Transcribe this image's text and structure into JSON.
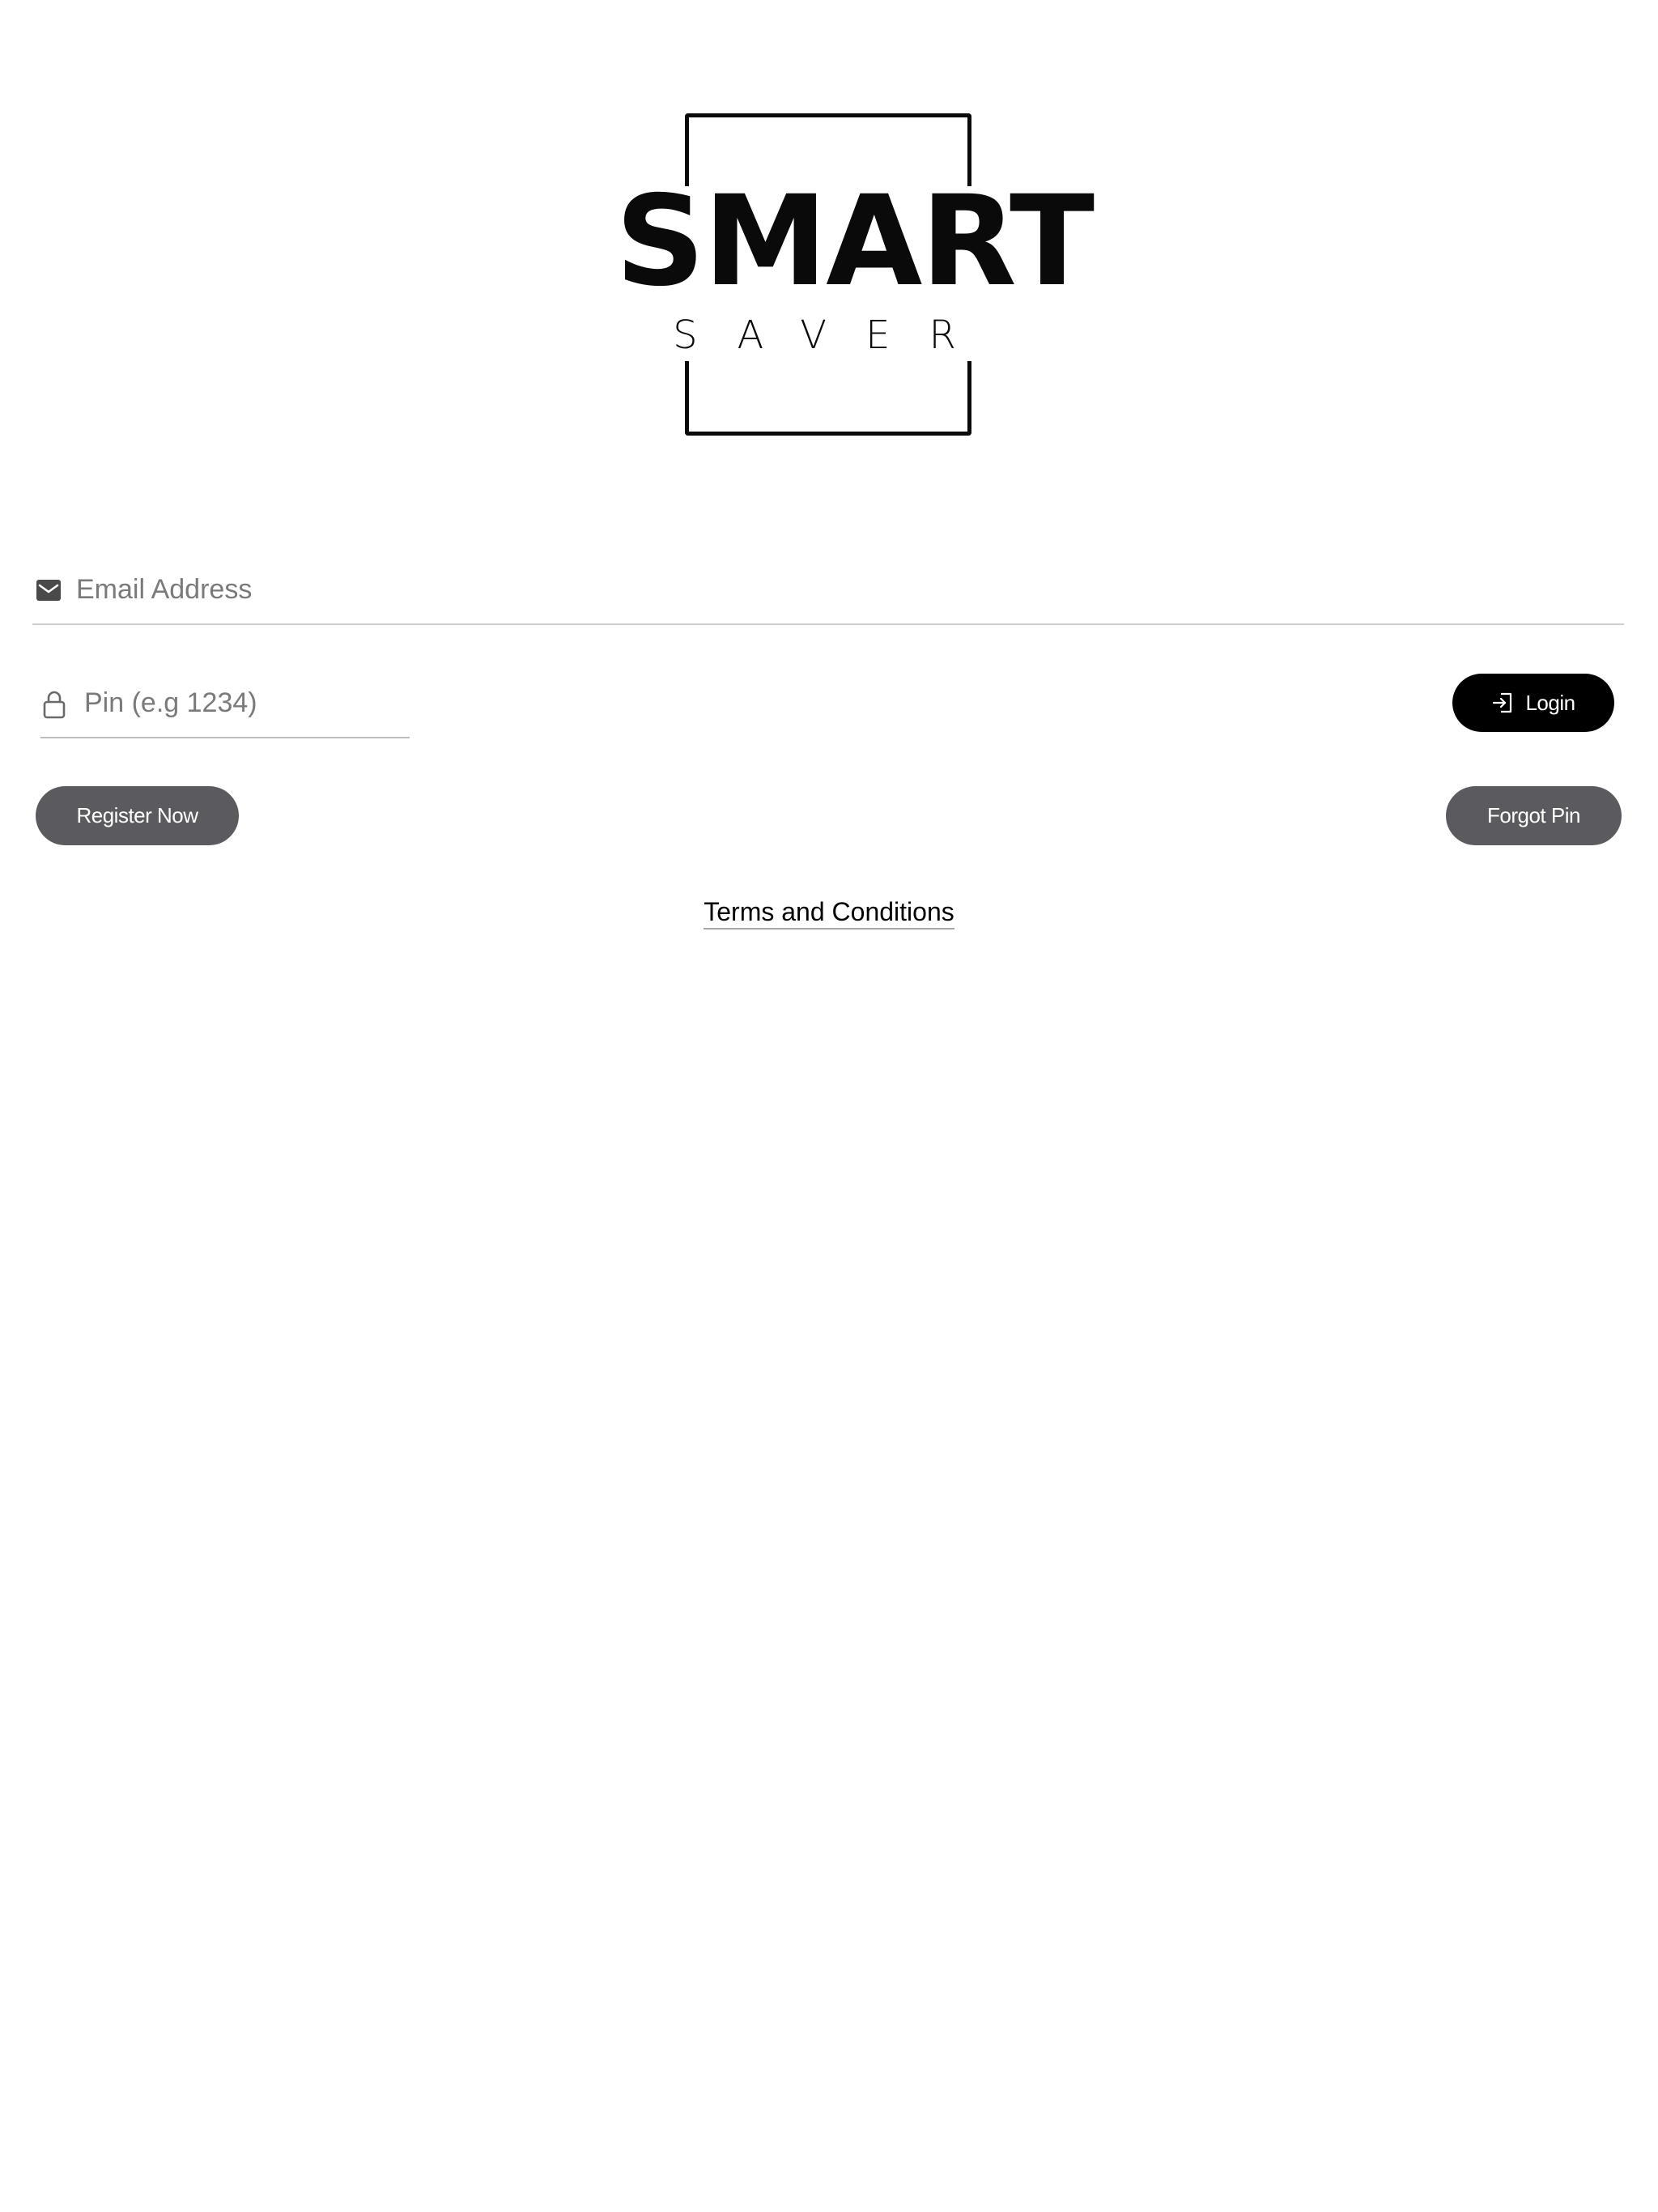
{
  "logo": {
    "word": "SMART",
    "subtitle": "SAVER"
  },
  "login_form": {
    "email": {
      "placeholder": "Email Address",
      "value": "",
      "icon": "envelope-icon"
    },
    "pin": {
      "placeholder": "Pin (e.g 1234)",
      "value": "",
      "icon": "lock-icon"
    },
    "login_button": {
      "label": "Login",
      "icon": "login-icon"
    }
  },
  "actions": {
    "register_label": "Register Now",
    "forgot_label": "Forgot Pin"
  },
  "footer": {
    "terms_label": "Terms and Conditions"
  },
  "colors": {
    "background": "#ffffff",
    "primary_button": "#000000",
    "secondary_button": "#5b5b5f",
    "input_placeholder": "#7a7a7a",
    "divider": "#cfcfcf"
  }
}
